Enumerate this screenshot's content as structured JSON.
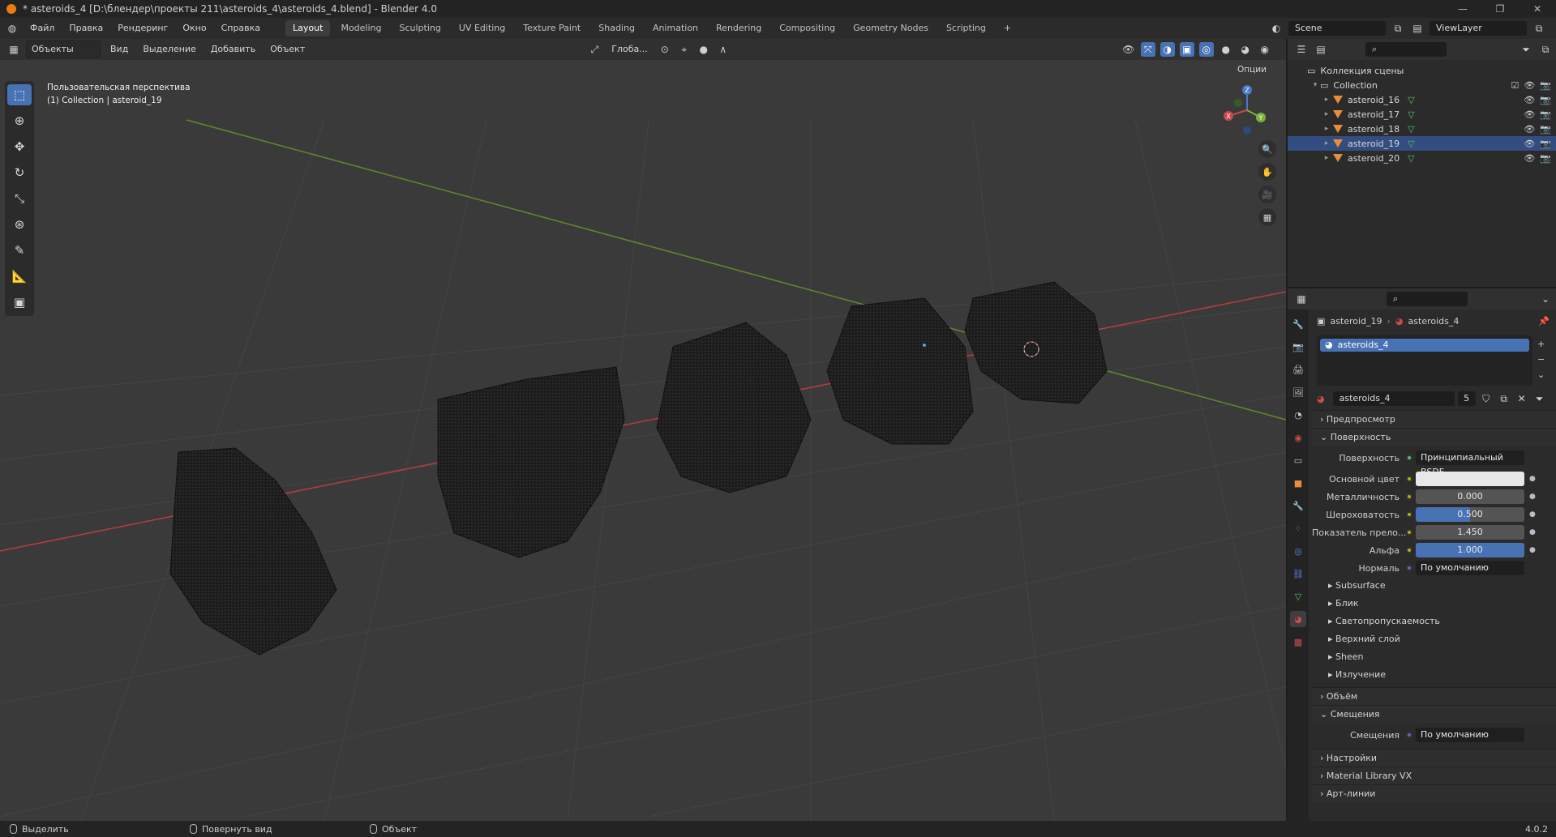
{
  "window": {
    "title": "* asteroids_4 [D:\\блендер\\проекты 211\\asteroids_4\\asteroids_4.blend] - Blender 4.0",
    "controls": [
      "—",
      "❐",
      "✕"
    ]
  },
  "menu": [
    "Файл",
    "Правка",
    "Рендеринг",
    "Окно",
    "Справка"
  ],
  "workspaces": [
    "Layout",
    "Modeling",
    "Sculpting",
    "UV Editing",
    "Texture Paint",
    "Shading",
    "Animation",
    "Rendering",
    "Compositing",
    "Geometry Nodes",
    "Scripting",
    "+"
  ],
  "active_workspace": "Layout",
  "scene": {
    "name": "Scene",
    "view_layer": "ViewLayer"
  },
  "viewport": {
    "mode": "Объекты",
    "menu": [
      "Вид",
      "Выделение",
      "Добавить",
      "Объект"
    ],
    "transform": "Глоба...",
    "options": "Опции",
    "info_line1": "Пользовательская перспектива",
    "info_line2": "(1) Collection | asteroid_19",
    "gizmo": {
      "x": "X",
      "y": "Y",
      "z": "Z"
    }
  },
  "tools": [
    "select-box",
    "cursor",
    "move",
    "rotate",
    "scale",
    "transform",
    "annotate",
    "measure",
    "add-cube"
  ],
  "outliner": {
    "root": "Коллекция сцены",
    "collection": "Collection",
    "items": [
      "asteroid_16",
      "asteroid_17",
      "asteroid_18",
      "asteroid_19",
      "asteroid_20"
    ]
  },
  "properties": {
    "breadcrumb_object": "asteroid_19",
    "breadcrumb_material": "asteroids_4",
    "slot": "asteroids_4",
    "material_name": "asteroids_4",
    "users": "5",
    "sections": {
      "preview": "Предпросмотр",
      "surface": "Поверхность",
      "volume": "Объём",
      "displacement": "Смещения",
      "settings": "Настройки",
      "library": "Material Library VX",
      "lineart": "Арт-линии"
    },
    "surface_label": "Поверхность",
    "surface_value": "Принципиальный BSDF",
    "base_color_label": "Основной цвет",
    "metallic_label": "Металличность",
    "metallic": "0.000",
    "roughness_label": "Шероховатость",
    "roughness": "0.500",
    "roughness_fill": 0.5,
    "ior_label": "Показатель прело...",
    "ior": "1.450",
    "alpha_label": "Альфа",
    "alpha": "1.000",
    "alpha_fill": 1.0,
    "normal_label": "Нормаль",
    "normal_value": "По умолчанию",
    "subpanels": [
      "Subsurface",
      "Блик",
      "Светопропускаемость",
      "Верхний слой",
      "Sheen",
      "Излучение"
    ],
    "disp_label": "Смещения",
    "disp_value": "По умолчанию"
  },
  "status": {
    "left": "Выделить",
    "middle": "Повернуть вид",
    "right": "Объект",
    "version": "4.0.2"
  },
  "colors": {
    "accent": "#4772b3",
    "x_axis": "#c94a4a",
    "y_axis": "#6a9a2f",
    "object": "#e88d3a",
    "mesh": "#52c36c"
  }
}
